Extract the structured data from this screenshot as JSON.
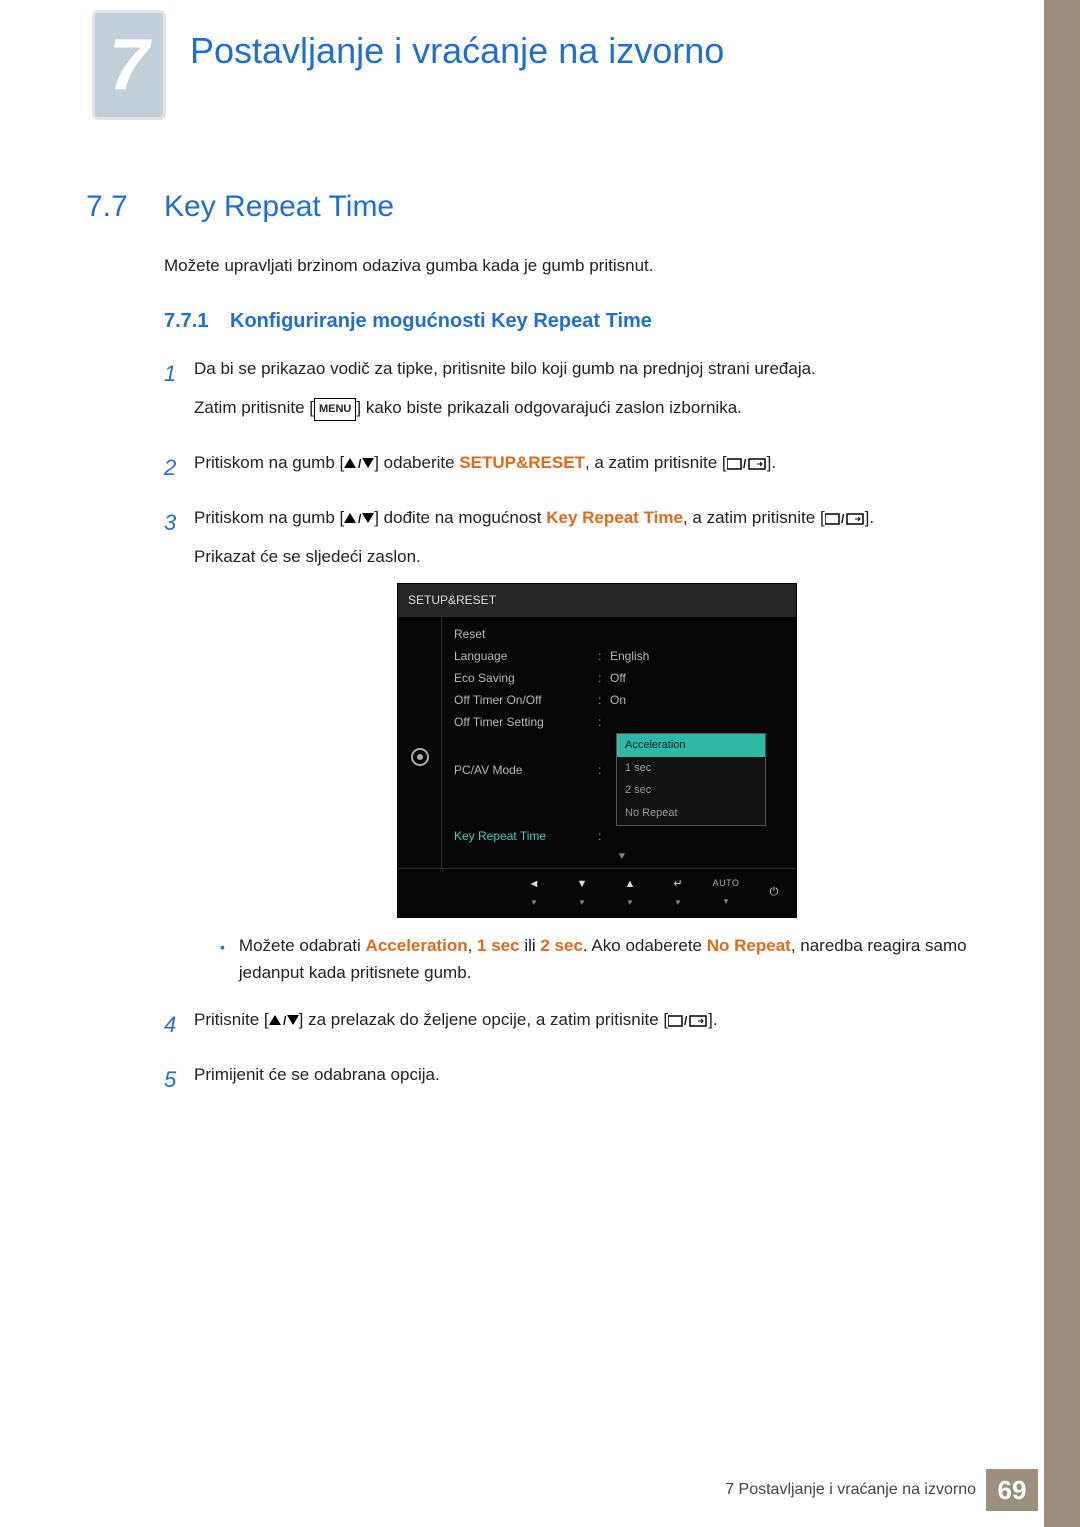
{
  "chapter": {
    "number": "7",
    "title": "Postavljanje i vraćanje na izvorno"
  },
  "section": {
    "number": "7.7",
    "title": "Key Repeat Time"
  },
  "intro": "Možete upravljati brzinom odaziva gumba kada je gumb pritisnut.",
  "subsection": {
    "number": "7.7.1",
    "title": "Konfiguriranje mogućnosti Key Repeat Time"
  },
  "steps": {
    "s1": {
      "n": "1",
      "p1": "Da bi se prikazao vodič za tipke, pritisnite bilo koji gumb na prednjoj strani uređaja.",
      "p2a": "Zatim pritisnite [",
      "menu": "MENU",
      "p2b": "] kako biste prikazali odgovarajući zaslon izbornika."
    },
    "s2": {
      "n": "2",
      "a": "Pritiskom na gumb [",
      "b": "] odaberite ",
      "hl": "SETUP&RESET",
      "c": ", a zatim pritisnite [",
      "d": "]."
    },
    "s3": {
      "n": "3",
      "a": "Pritiskom na gumb [",
      "b": "] dođite na mogućnost ",
      "hl": "Key Repeat Time",
      "c": ", a zatim pritisnite [",
      "d": "].",
      "p2": "Prikazat će se sljedeći zaslon."
    },
    "bullet": {
      "a": "Možete odabrati ",
      "h1": "Acceleration",
      "s1": ", ",
      "h2": "1 sec",
      "s2": " ili ",
      "h3": "2 sec",
      "b": ". Ako odaberete ",
      "h4": "No Repeat",
      "c": ", naredba reagira samo jedanput kada pritisnete gumb."
    },
    "s4": {
      "n": "4",
      "a": "Pritisnite [",
      "b": "] za prelazak do željene opcije, a zatim pritisnite [",
      "c": "]."
    },
    "s5": {
      "n": "5",
      "a": "Primijenit će se odabrana opcija."
    }
  },
  "osd": {
    "title": "SETUP&RESET",
    "rows": {
      "reset": {
        "label": "Reset",
        "value": ""
      },
      "lang": {
        "label": "Language",
        "value": "English"
      },
      "eco": {
        "label": "Eco Saving",
        "value": "Off"
      },
      "timerOn": {
        "label": "Off Timer On/Off",
        "value": "On"
      },
      "timerSt": {
        "label": "Off Timer Setting",
        "value": ""
      },
      "pcav": {
        "label": "PC/AV Mode",
        "value": ""
      },
      "krt": {
        "label": "Key Repeat Time",
        "value": ""
      }
    },
    "options": {
      "o1": "Acceleration",
      "o2": "1 sec",
      "o3": "2 sec",
      "o4": "No Repeat"
    },
    "nav": {
      "auto": "AUTO"
    }
  },
  "footer": {
    "text": "7 Postavljanje i vraćanje na izvorno",
    "page": "69"
  }
}
